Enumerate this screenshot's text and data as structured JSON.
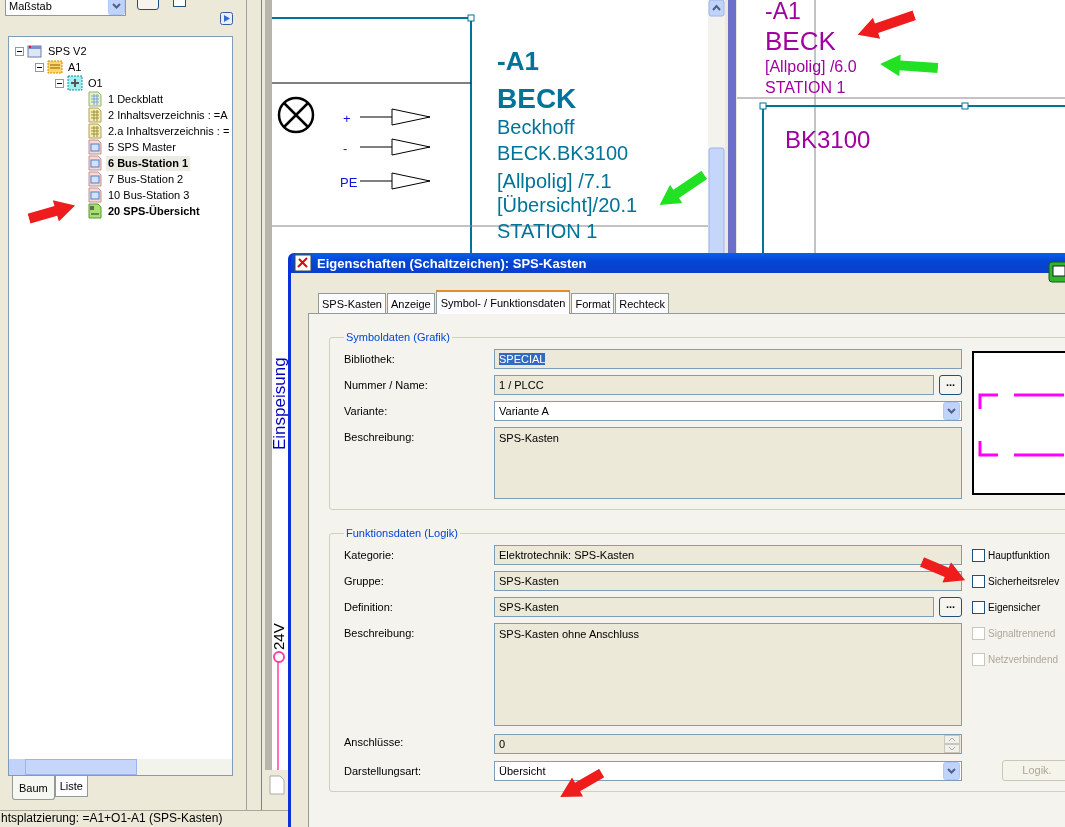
{
  "toolbar": {
    "scale_select": "Maßstab",
    "option": {
      "checked": false
    }
  },
  "tree": [
    {
      "label": "SPS V2",
      "kind": "project",
      "expanded": true,
      "children": [
        {
          "label": "A1",
          "kind": "location",
          "expanded": true,
          "children": [
            {
              "label": "O1",
              "kind": "installation",
              "expanded": true,
              "children": [
                {
                  "label": "1 Deckblatt",
                  "kind": "cover",
                  "bold": false,
                  "selected": false
                },
                {
                  "label": "2 Inhaltsverzeichnis : =A",
                  "kind": "toc",
                  "bold": false,
                  "selected": false
                },
                {
                  "label": "2.a Inhaltsverzeichnis : =",
                  "kind": "toc",
                  "bold": false,
                  "selected": false
                },
                {
                  "label": "5 SPS Master",
                  "kind": "schematic",
                  "bold": false,
                  "selected": false
                },
                {
                  "label": "6 Bus-Station 1",
                  "kind": "schematic",
                  "bold": true,
                  "selected": true
                },
                {
                  "label": "7 Bus-Station 2",
                  "kind": "schematic",
                  "bold": false,
                  "selected": false
                },
                {
                  "label": "10 Bus-Station 3",
                  "kind": "schematic",
                  "bold": false,
                  "selected": false
                },
                {
                  "label": "20 SPS-Übersicht",
                  "kind": "overview",
                  "bold": true,
                  "selected": false
                }
              ]
            }
          ]
        }
      ]
    }
  ],
  "tree_tabs": [
    {
      "label": "Baum",
      "selected": true
    },
    {
      "label": "Liste",
      "selected": false
    }
  ],
  "schematic": {
    "left_sheet": {
      "connections": [
        "+",
        "-",
        "PE"
      ],
      "lines": [
        "-A1",
        "BECK",
        "Beckhoff",
        "BECK.BK3100",
        "[Allpolig] /7.1",
        "[Übersicht]/20.1",
        "STATION 1"
      ]
    },
    "right_sheet": {
      "lines": [
        "-A1",
        "BECK",
        "[Allpolig] /6.0",
        "STATION 1"
      ],
      "device": "BK3100"
    },
    "vertical_labels": [
      "Einspeisung",
      "24V"
    ]
  },
  "dialog": {
    "title": "Eigenschaften (Schaltzeichen): SPS-Kasten",
    "tabs": [
      {
        "label": "SPS-Kasten",
        "selected": false
      },
      {
        "label": "Anzeige",
        "selected": false
      },
      {
        "label": "Symbol- / Funktionsdaten",
        "selected": true
      },
      {
        "label": "Format",
        "selected": false
      },
      {
        "label": "Rechteck",
        "selected": false
      }
    ],
    "groups": [
      {
        "kind": "symbol",
        "title": "Symboldaten (Grafik)",
        "fields": [
          {
            "label": "Bibliothek:",
            "value": "SPECIAL",
            "kind": "text",
            "highlighted": true
          },
          {
            "label": "Nummer / Name:",
            "value": "1 / PLCC",
            "kind": "browse",
            "button": "...",
            "highlighted": false
          },
          {
            "label": "Variante:",
            "value": "Variante A",
            "kind": "select",
            "highlighted": false
          },
          {
            "label": "Beschreibung:",
            "value": "SPS-Kasten",
            "kind": "memo",
            "highlighted": false
          }
        ]
      },
      {
        "kind": "function",
        "title": "Funktionsdaten (Logik)",
        "fields": [
          {
            "label": "Kategorie:",
            "value": "Elektrotechnik: SPS-Kasten",
            "kind": "text",
            "highlighted": false
          },
          {
            "label": "Gruppe:",
            "value": "SPS-Kasten",
            "kind": "text",
            "highlighted": false
          },
          {
            "label": "Definition:",
            "value": "SPS-Kasten",
            "kind": "browse",
            "button": "...",
            "highlighted": false
          },
          {
            "label": "Beschreibung:",
            "value": "SPS-Kasten ohne Anschluss",
            "kind": "memo",
            "highlighted": false
          },
          {
            "label": "Anschlüsse:",
            "value": "0",
            "kind": "spin",
            "highlighted": false
          },
          {
            "label": "Darstellungsart:",
            "value": "Übersicht",
            "kind": "select",
            "highlighted": false
          }
        ],
        "checkboxes": [
          {
            "label": "Hauptfunktion",
            "checked": false,
            "disabled": false
          },
          {
            "label": "Sicherheitsrelev",
            "checked": false,
            "disabled": false
          },
          {
            "label": "Eigensicher",
            "checked": false,
            "disabled": false
          },
          {
            "label": "Signaltrennend",
            "checked": false,
            "disabled": true
          },
          {
            "label": "Netzverbindend",
            "checked": false,
            "disabled": true
          }
        ],
        "button": {
          "label": "Logik.",
          "disabled": true
        }
      }
    ]
  },
  "status_bar": "htsplatzierung: =A1+O1-A1 (SPS-Kasten)"
}
